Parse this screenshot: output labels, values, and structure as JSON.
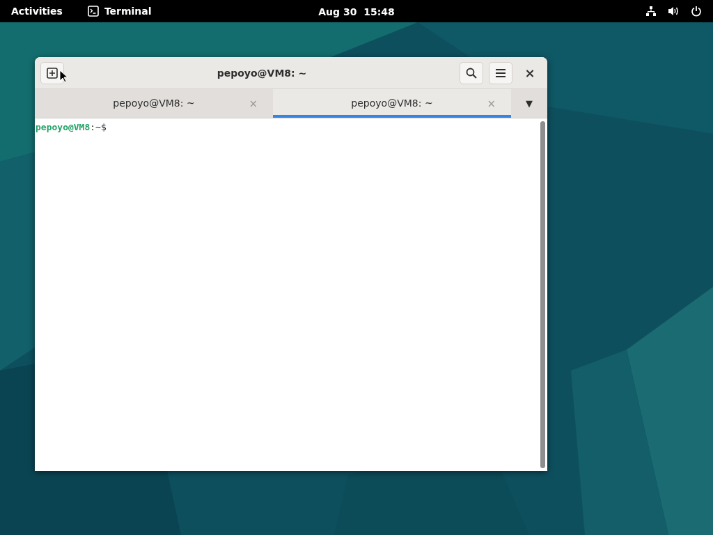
{
  "top_bar": {
    "activities": "Activities",
    "app_name": "Terminal",
    "clock": "Aug 30  15:48"
  },
  "window": {
    "title": "pepoyo@VM8: ~",
    "close": "×"
  },
  "tabs": [
    {
      "label": "pepoyo@VM8: ~",
      "close": "×",
      "selected": false
    },
    {
      "label": "pepoyo@VM8: ~",
      "close": "×",
      "selected": true
    }
  ],
  "tab_menu": "▼",
  "terminal": {
    "user_host": "pepoyo@VM8",
    "rest": ":~$"
  }
}
